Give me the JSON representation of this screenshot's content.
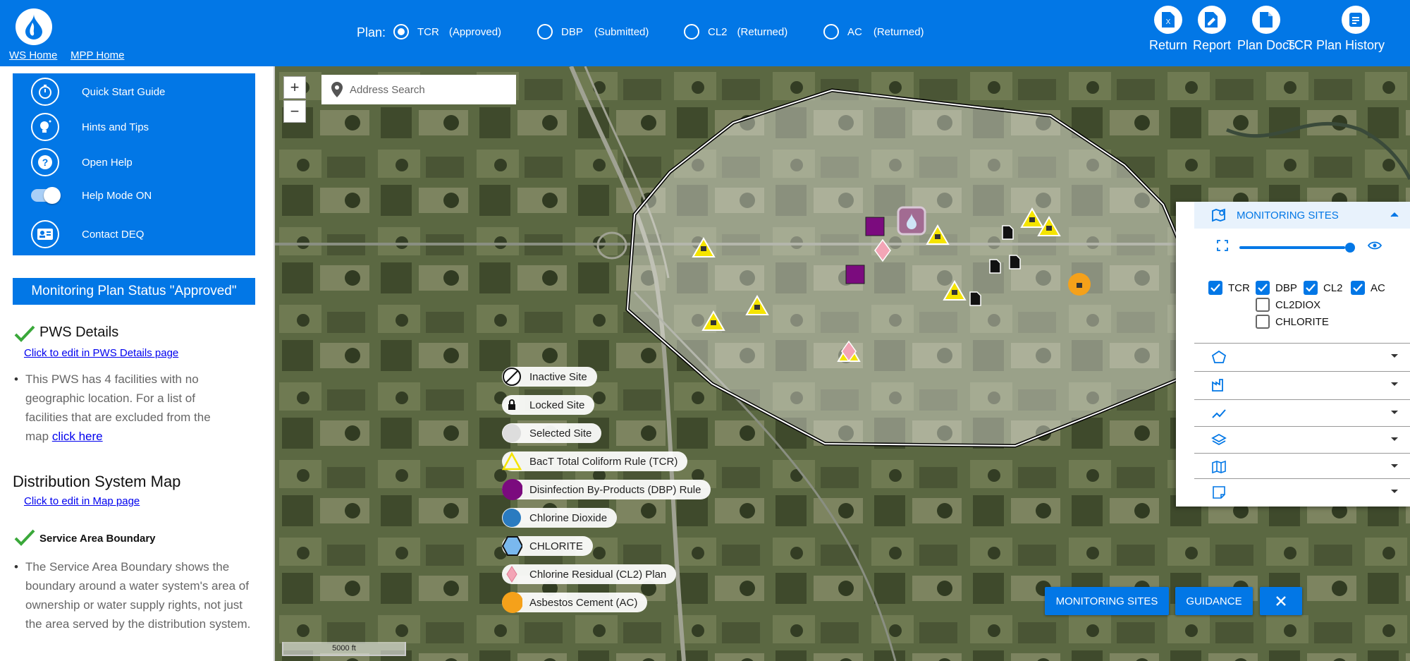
{
  "header": {
    "links": {
      "ws_home": "WS Home",
      "mpp_home": "MPP Home"
    },
    "plan_label": "Plan:",
    "plans": [
      {
        "name": "TCR",
        "status": "(Approved)",
        "selected": true
      },
      {
        "name": "DBP",
        "status": "(Submitted)",
        "selected": false
      },
      {
        "name": "CL2",
        "status": "(Returned)",
        "selected": false
      },
      {
        "name": "AC",
        "status": "(Returned)",
        "selected": false
      }
    ],
    "actions": [
      {
        "label": "Return",
        "icon": "excel-file-icon"
      },
      {
        "label": "Report",
        "icon": "edit-document-icon"
      },
      {
        "label": "Plan Docs",
        "icon": "document-icon"
      },
      {
        "label": "TCR Plan History",
        "icon": "history-document-icon"
      }
    ]
  },
  "help_menu": [
    {
      "label": "Quick Start Guide",
      "icon": "stopwatch-icon"
    },
    {
      "label": "Hints and Tips",
      "icon": "lightbulb-icon"
    },
    {
      "label": "Open Help",
      "icon": "question-icon"
    },
    {
      "label": "Help Mode ON",
      "icon": "toggle-icon",
      "on": true
    },
    {
      "label": "Contact DEQ",
      "icon": "contact-card-icon"
    }
  ],
  "status_banner": "Monitoring Plan Status \"Approved\"",
  "pws_details": {
    "title": "PWS Details",
    "edit_link": "Click to edit in PWS Details page",
    "text": "This PWS has 4 facilities with no geographic location. For a list of facilities that are excluded from the map",
    "link": "click here"
  },
  "distribution": {
    "title": "Distribution System Map",
    "edit_link": "Click to edit in Map page"
  },
  "service_area": {
    "title": "Service Area Boundary",
    "text": "The Service Area Boundary shows the boundary around a water system's area of ownership or water supply rights, not just the area served by the distribution system."
  },
  "map": {
    "address_placeholder": "Address Search",
    "zoom_in": "+",
    "zoom_out": "−",
    "scale": "5000 ft"
  },
  "legend": [
    {
      "label": "Inactive Site",
      "icon": "inactive-icon"
    },
    {
      "label": "Locked Site",
      "icon": "lock-icon"
    },
    {
      "label": "Selected Site",
      "icon": "selected-circle-icon"
    },
    {
      "label": "BacT Total Coliform Rule (TCR)",
      "icon": "triangle-icon",
      "color": "#f5e400"
    },
    {
      "label": "Disinfection By-Products (DBP) Rule",
      "icon": "circle-icon",
      "color": "#7b0b7e"
    },
    {
      "label": "Chlorine Dioxide",
      "icon": "circle-icon",
      "color": "#2a7bc0"
    },
    {
      "label": "CHLORITE",
      "icon": "hexagon-icon",
      "color": "#7ab8ee"
    },
    {
      "label": "Chlorine Residual (CL2) Plan",
      "icon": "diamond-icon",
      "color": "#f3a5b6"
    },
    {
      "label": "Asbestos Cement (AC)",
      "icon": "circle-icon",
      "color": "#f5a11a"
    }
  ],
  "monitoring_panel": {
    "title": "MONITORING SITES",
    "opacity": 1.0,
    "checkboxes": [
      {
        "label": "TCR",
        "checked": true
      },
      {
        "label": "DBP",
        "checked": true
      },
      {
        "label": "CL2",
        "checked": true
      },
      {
        "label": "AC",
        "checked": true
      },
      {
        "label": "CL2DIOX",
        "checked": false
      },
      {
        "label": "CHLORITE",
        "checked": false
      }
    ],
    "accordions": [
      {
        "icon": "pentagon-icon"
      },
      {
        "icon": "factory-icon"
      },
      {
        "icon": "line-chart-icon"
      },
      {
        "icon": "layers-icon"
      },
      {
        "icon": "map-icon"
      },
      {
        "icon": "note-icon"
      }
    ]
  },
  "bottom_buttons": {
    "monitoring_sites": "MONITORING SITES",
    "guidance": "GUIDANCE"
  },
  "colors": {
    "brand": "#0277e6",
    "check": "#3aa83a"
  }
}
